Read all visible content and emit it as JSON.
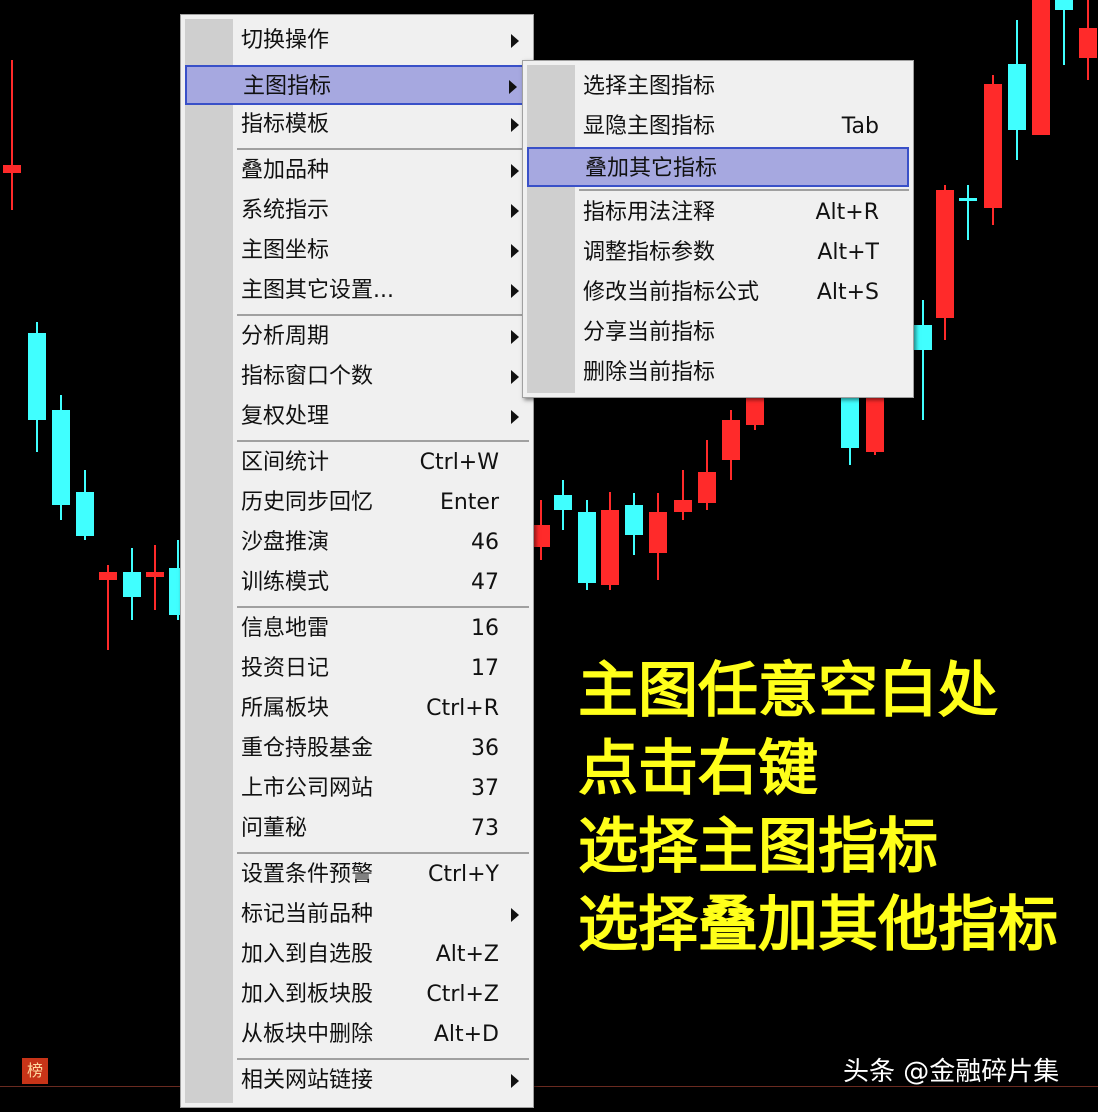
{
  "colors": {
    "background": "#000000",
    "up_candle": "#ff2a2a",
    "down_candle": "#40ffff",
    "menu_bg": "#f0f0f0",
    "menu_highlight": "#a6a8e0",
    "menu_highlight_border": "#3950c8",
    "caption": "#ffff1a"
  },
  "context_menu": {
    "items": [
      {
        "label": "切换操作",
        "shortcut": "",
        "submenu": true
      },
      {
        "label": "主图指标",
        "shortcut": "",
        "submenu": true,
        "highlighted": true
      },
      {
        "label": "指标模板",
        "shortcut": "",
        "submenu": true
      },
      {
        "label": "叠加品种",
        "shortcut": "",
        "submenu": true
      },
      {
        "label": "系统指示",
        "shortcut": "",
        "submenu": true
      },
      {
        "label": "主图坐标",
        "shortcut": "",
        "submenu": true
      },
      {
        "label": "主图其它设置...",
        "shortcut": "",
        "submenu": true
      },
      {
        "label": "分析周期",
        "shortcut": "",
        "submenu": true
      },
      {
        "label": "指标窗口个数",
        "shortcut": "",
        "submenu": true
      },
      {
        "label": "复权处理",
        "shortcut": "",
        "submenu": true
      },
      {
        "label": "区间统计",
        "shortcut": "Ctrl+W",
        "submenu": false
      },
      {
        "label": "历史同步回忆",
        "shortcut": "Enter",
        "submenu": false
      },
      {
        "label": "沙盘推演",
        "shortcut": "46",
        "submenu": false
      },
      {
        "label": "训练模式",
        "shortcut": "47",
        "submenu": false
      },
      {
        "label": "信息地雷",
        "shortcut": "16",
        "submenu": false
      },
      {
        "label": "投资日记",
        "shortcut": "17",
        "submenu": false
      },
      {
        "label": "所属板块",
        "shortcut": "Ctrl+R",
        "submenu": false
      },
      {
        "label": "重仓持股基金",
        "shortcut": "36",
        "submenu": false
      },
      {
        "label": "上市公司网站",
        "shortcut": "37",
        "submenu": false
      },
      {
        "label": "问董秘",
        "shortcut": "73",
        "submenu": false
      },
      {
        "label": "设置条件预警",
        "shortcut": "Ctrl+Y",
        "submenu": false
      },
      {
        "label": "标记当前品种",
        "shortcut": "",
        "submenu": true
      },
      {
        "label": "加入到自选股",
        "shortcut": "Alt+Z",
        "submenu": false
      },
      {
        "label": "加入到板块股",
        "shortcut": "Ctrl+Z",
        "submenu": false
      },
      {
        "label": "从板块中删除",
        "shortcut": "Alt+D",
        "submenu": false
      },
      {
        "label": "相关网站链接",
        "shortcut": "",
        "submenu": true
      }
    ]
  },
  "submenu": {
    "items": [
      {
        "label": "选择主图指标",
        "shortcut": ""
      },
      {
        "label": "显隐主图指标",
        "shortcut": "Tab"
      },
      {
        "label": "叠加其它指标",
        "shortcut": "",
        "highlighted": true
      },
      {
        "label": "指标用法注释",
        "shortcut": "Alt+R"
      },
      {
        "label": "调整指标参数",
        "shortcut": "Alt+T"
      },
      {
        "label": "修改当前指标公式",
        "shortcut": "Alt+S"
      },
      {
        "label": "分享当前指标",
        "shortcut": ""
      },
      {
        "label": "删除当前指标",
        "shortcut": ""
      }
    ]
  },
  "caption_lines": [
    "主图任意空白处",
    "点击右键",
    "选择主图指标",
    "选择叠加其他指标"
  ],
  "watermark": "头条 @金融碎片集"
}
